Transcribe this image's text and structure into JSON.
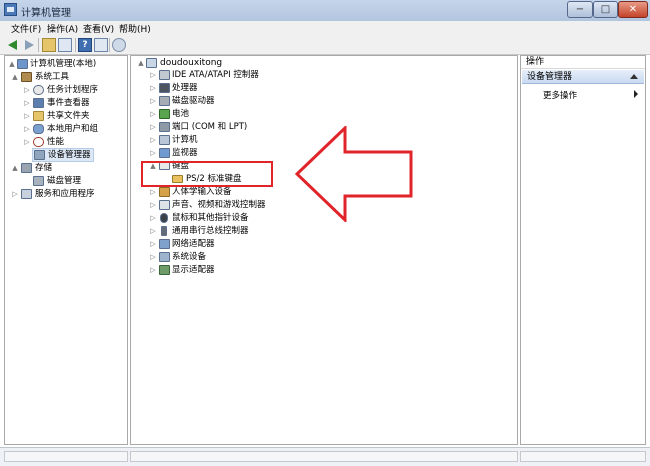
{
  "window": {
    "title": "计算机管理",
    "min_glyph": "−",
    "max_glyph": "□",
    "close_glyph": "✕"
  },
  "menu": {
    "file": "文件(F)",
    "action": "操作(A)",
    "view": "查看(V)",
    "help": "帮助(H)"
  },
  "toolbar": {
    "help_glyph": "?"
  },
  "left_tree": {
    "root": "计算机管理(本地)",
    "system_tools": "系统工具",
    "task_scheduler": "任务计划程序",
    "event_viewer": "事件查看器",
    "shared_folders": "共享文件夹",
    "local_users": "本地用户和组",
    "performance": "性能",
    "device_manager": "设备管理器",
    "storage": "存储",
    "disk_management": "磁盘管理",
    "services_apps": "服务和应用程序"
  },
  "device_tree": {
    "computer": "doudouxitong",
    "items": {
      "ide": "IDE ATA/ATAPI 控制器",
      "cpu": "处理器",
      "disk": "磁盘驱动器",
      "battery": "电池",
      "ports": "端口 (COM 和 LPT)",
      "computer": "计算机",
      "monitor": "监视器",
      "keyboard": "键盘",
      "ps2_keyboard": "PS/2 标准键盘",
      "hid": "人体学输入设备",
      "sound": "声音、视频和游戏控制器",
      "mouse": "鼠标和其他指针设备",
      "usb": "通用串行总线控制器",
      "network": "网络适配器",
      "system": "系统设备",
      "display": "显示适配器"
    }
  },
  "actions_pane": {
    "header": "操作",
    "section": "设备管理器",
    "more": "更多操作"
  },
  "colors": {
    "highlight_red": "#e0242a",
    "selection_blue": "#dde8f6"
  },
  "icons": {
    "back": "back-arrow-icon",
    "forward": "forward-arrow-icon",
    "up": "up-folder-icon",
    "console_tree": "console-tree-icon",
    "help": "help-icon",
    "properties": "properties-icon",
    "scan": "scan-hardware-icon"
  }
}
